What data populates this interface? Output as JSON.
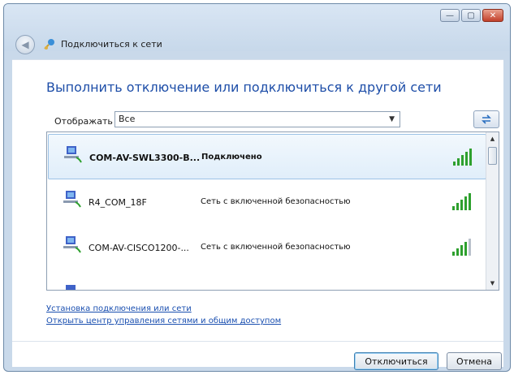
{
  "window": {
    "title": "Подключиться к сети",
    "caption_buttons": {
      "minimize": "—",
      "maximize": "▢",
      "close": "✕"
    }
  },
  "main": {
    "heading": "Выполнить отключение или подключиться к другой сети",
    "filter": {
      "label": "Отображать",
      "value": "Все"
    }
  },
  "networks": [
    {
      "name": "COM-AV-SWL3300-B...",
      "status": "Подключено",
      "signal": 5
    },
    {
      "name": "R4_COM_18F",
      "status": "Сеть с включенной безопасностью",
      "signal": 5
    },
    {
      "name": "COM-AV-CISCO1200-...",
      "status": "Сеть с включенной безопасностью",
      "signal": 4
    }
  ],
  "links": {
    "setup": "Установка подключения или сети",
    "network_center": "Открыть центр управления сетями и общим доступом"
  },
  "buttons": {
    "disconnect": "Отключиться",
    "cancel": "Отмена"
  },
  "colors": {
    "heading": "#1e4ea8",
    "link": "#1a4fb0",
    "signal_green": "#2ea02e"
  }
}
